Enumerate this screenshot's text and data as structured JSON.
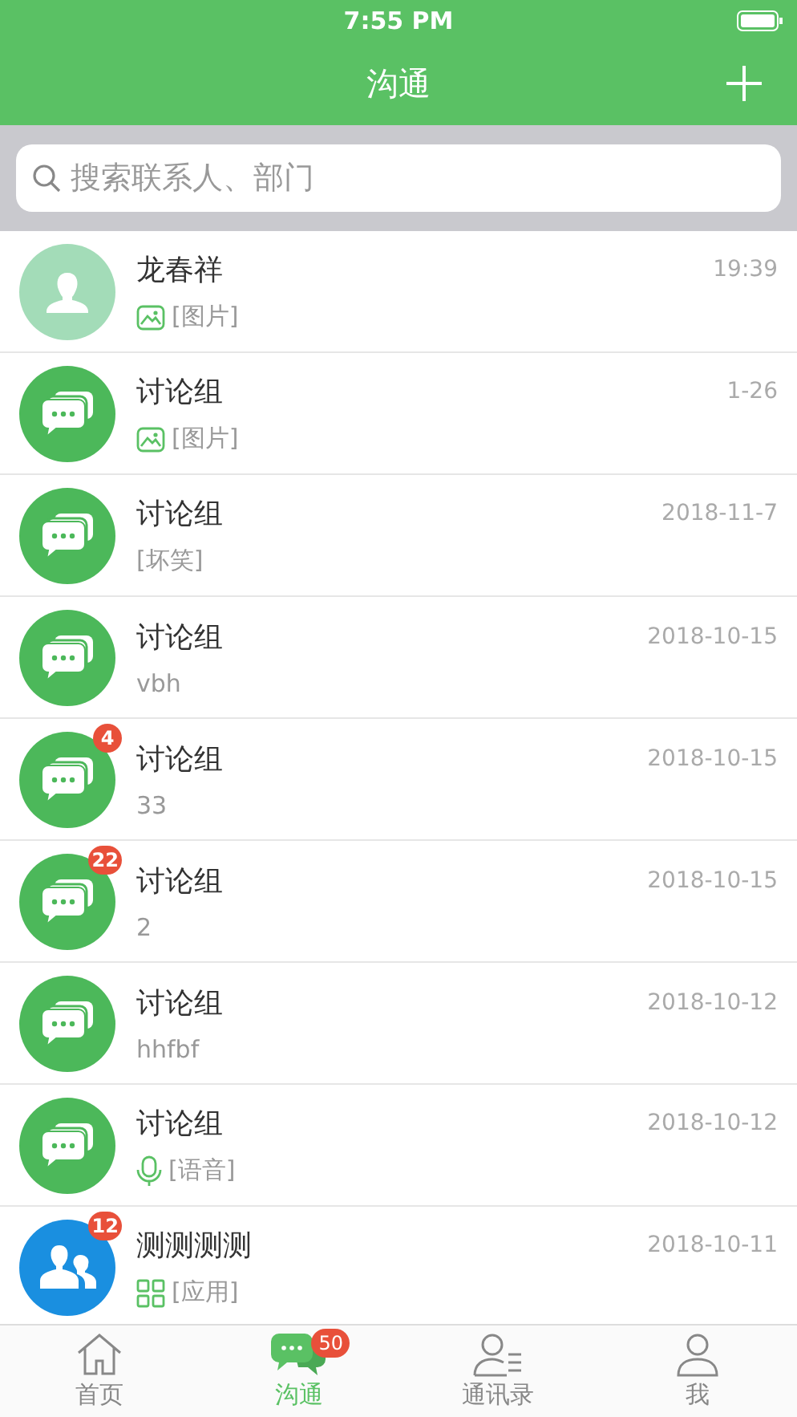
{
  "status_bar": {
    "time": "7:55 PM"
  },
  "nav": {
    "title": "沟通"
  },
  "search": {
    "placeholder": "搜索联系人、部门"
  },
  "conversations": [
    {
      "kind": "person",
      "name": "龙春祥",
      "preview": {
        "kind": "image",
        "text": "[图片]"
      },
      "time": "19:39"
    },
    {
      "kind": "group",
      "name": "讨论组",
      "preview": {
        "kind": "image",
        "text": "[图片]"
      },
      "time": "1-26"
    },
    {
      "kind": "group",
      "name": "讨论组",
      "preview": {
        "kind": "text",
        "text": "[坏笑]"
      },
      "time": "2018-11-7"
    },
    {
      "kind": "group",
      "name": "讨论组",
      "preview": {
        "kind": "text",
        "text": "vbh"
      },
      "time": "2018-10-15"
    },
    {
      "kind": "group",
      "name": "讨论组",
      "badge": "4",
      "preview": {
        "kind": "text",
        "text": "33"
      },
      "time": "2018-10-15"
    },
    {
      "kind": "group",
      "name": "讨论组",
      "badge": "22",
      "preview": {
        "kind": "text",
        "text": "2"
      },
      "time": "2018-10-15"
    },
    {
      "kind": "group",
      "name": "讨论组",
      "preview": {
        "kind": "text",
        "text": "hhfbf"
      },
      "time": "2018-10-12"
    },
    {
      "kind": "group",
      "name": "讨论组",
      "preview": {
        "kind": "voice",
        "text": "[语音]"
      },
      "time": "2018-10-12"
    },
    {
      "kind": "team",
      "name": "测测测测",
      "badge": "12",
      "preview": {
        "kind": "app",
        "text": "[应用]"
      },
      "time": "2018-10-11"
    }
  ],
  "tabs": [
    {
      "kind": "home",
      "label": "首页",
      "selected": false
    },
    {
      "kind": "chat",
      "label": "沟通",
      "selected": true,
      "badge": "50"
    },
    {
      "kind": "contacts",
      "label": "通讯录",
      "selected": false
    },
    {
      "kind": "me",
      "label": "我",
      "selected": false
    }
  ]
}
